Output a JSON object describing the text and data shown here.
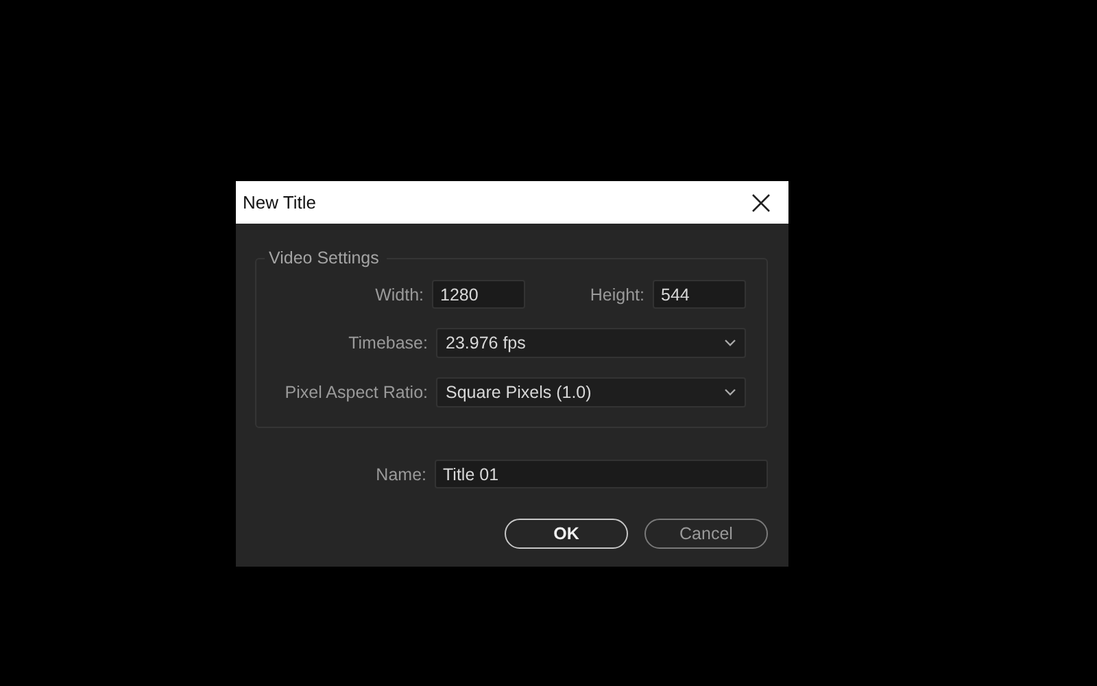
{
  "window": {
    "title": "New Title"
  },
  "video_settings": {
    "legend": "Video Settings",
    "width": {
      "label": "Width:",
      "value": "1280"
    },
    "height": {
      "label": "Height:",
      "value": "544"
    },
    "timebase": {
      "label": "Timebase:",
      "value": "23.976 fps"
    },
    "pixel_aspect_ratio": {
      "label": "Pixel Aspect Ratio:",
      "value": "Square Pixels (1.0)"
    }
  },
  "name": {
    "label": "Name:",
    "value": "Title 01"
  },
  "buttons": [
    {
      "label": "OK",
      "kind": "default"
    },
    {
      "label": "Cancel",
      "kind": "normal"
    }
  ]
}
